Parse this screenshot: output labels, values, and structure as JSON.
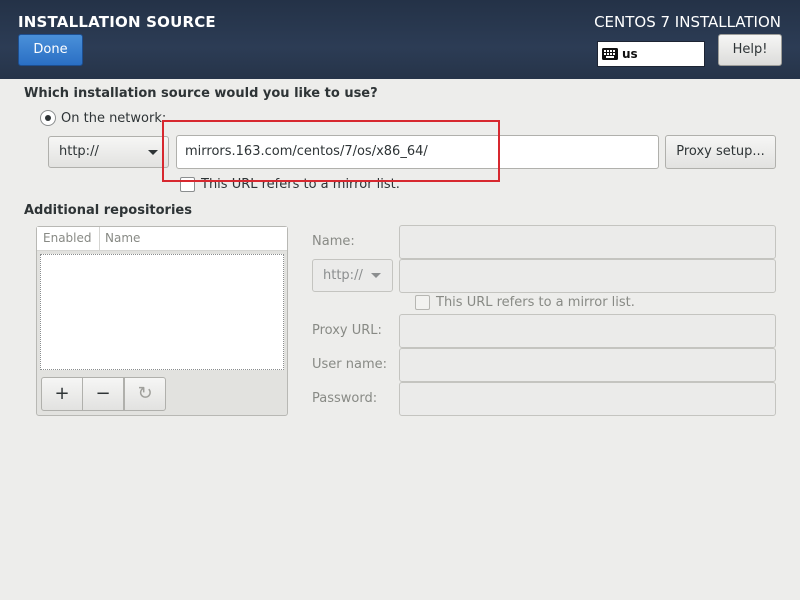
{
  "header": {
    "title": "INSTALLATION SOURCE",
    "product": "CENTOS 7 INSTALLATION",
    "done_label": "Done",
    "keyboard_layout": "us",
    "help_label": "Help!"
  },
  "source": {
    "question": "Which installation source would you like to use?",
    "network_option": "On the network:",
    "protocol": "http://",
    "url": "mirrors.163.com/centos/7/os/x86_64/",
    "proxy_label": "Proxy setup...",
    "mirror_list_label": "This URL refers to a mirror list."
  },
  "additional": {
    "heading": "Additional repositories",
    "columns": [
      "Enabled",
      "Name"
    ],
    "add_label": "+",
    "remove_label": "−",
    "refresh_label": "↻"
  },
  "repo_form": {
    "name_label": "Name:",
    "protocol": "http://",
    "mirror_list_label": "This URL refers to a mirror list.",
    "proxy_url_label": "Proxy URL:",
    "username_label": "User name:",
    "password_label": "Password:"
  },
  "colors": {
    "header_bg": "#263449",
    "accent": "#2a6fc4",
    "highlight": "#d7282f"
  }
}
